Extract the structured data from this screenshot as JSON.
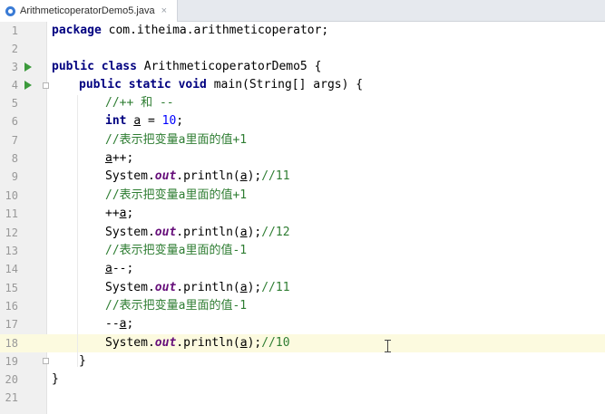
{
  "tab": {
    "label": "ArithmeticoperatorDemo5.java",
    "close": "×",
    "icon": "java-class-icon"
  },
  "lines": [
    {
      "n": "1"
    },
    {
      "n": "2"
    },
    {
      "n": "3"
    },
    {
      "n": "4"
    },
    {
      "n": "5"
    },
    {
      "n": "6"
    },
    {
      "n": "7"
    },
    {
      "n": "8"
    },
    {
      "n": "9"
    },
    {
      "n": "10"
    },
    {
      "n": "11"
    },
    {
      "n": "12"
    },
    {
      "n": "13"
    },
    {
      "n": "14"
    },
    {
      "n": "15"
    },
    {
      "n": "16"
    },
    {
      "n": "17"
    },
    {
      "n": "18"
    },
    {
      "n": "19"
    },
    {
      "n": "20"
    },
    {
      "n": "21"
    }
  ],
  "code": {
    "l1": {
      "kw": "package",
      "rest": " com.itheima.arithmeticoperator;"
    },
    "l3": {
      "kw": "public class",
      "rest": " ArithmeticoperatorDemo5 {"
    },
    "l4": {
      "kw": "public static void",
      "rest": " main(String[] args) {"
    },
    "l5": {
      "cmt": "//++ 和 --"
    },
    "l6": {
      "kw": "int",
      "var": "a",
      "rest": " = ",
      "num": "10",
      "end": ";"
    },
    "l7": {
      "cmt": "//表示把变量a里面的值+1"
    },
    "l8": {
      "var": "a",
      "rest": "++;"
    },
    "l9": {
      "a": "System.",
      "field": "out",
      "b": ".println(",
      "var": "a",
      "c": ");",
      "cmt": "//11"
    },
    "l10": {
      "cmt": "//表示把变量a里面的值+1"
    },
    "l11": {
      "pre": "++",
      "var": "a",
      "rest": ";"
    },
    "l12": {
      "a": "System.",
      "field": "out",
      "b": ".println(",
      "var": "a",
      "c": ");",
      "cmt": "//12"
    },
    "l13": {
      "cmt": "//表示把变量a里面的值-1"
    },
    "l14": {
      "var": "a",
      "rest": "--;"
    },
    "l15": {
      "a": "System.",
      "field": "out",
      "b": ".println(",
      "var": "a",
      "c": ");",
      "cmt": "//11"
    },
    "l16": {
      "cmt": "//表示把变量a里面的值-1"
    },
    "l17": {
      "pre": "--",
      "var": "a",
      "rest": ";"
    },
    "l18": {
      "a": "System.",
      "field": "out",
      "b": ".println(",
      "var": "a",
      "c": ");",
      "cmt": "//10"
    },
    "l19": {
      "rest": "}"
    },
    "l20": {
      "rest": "}"
    }
  },
  "colors": {
    "keyword": "#000080",
    "number": "#0000ff",
    "comment": "#2e7d32",
    "field": "#660e7a",
    "current_line": "#fcfadf"
  }
}
